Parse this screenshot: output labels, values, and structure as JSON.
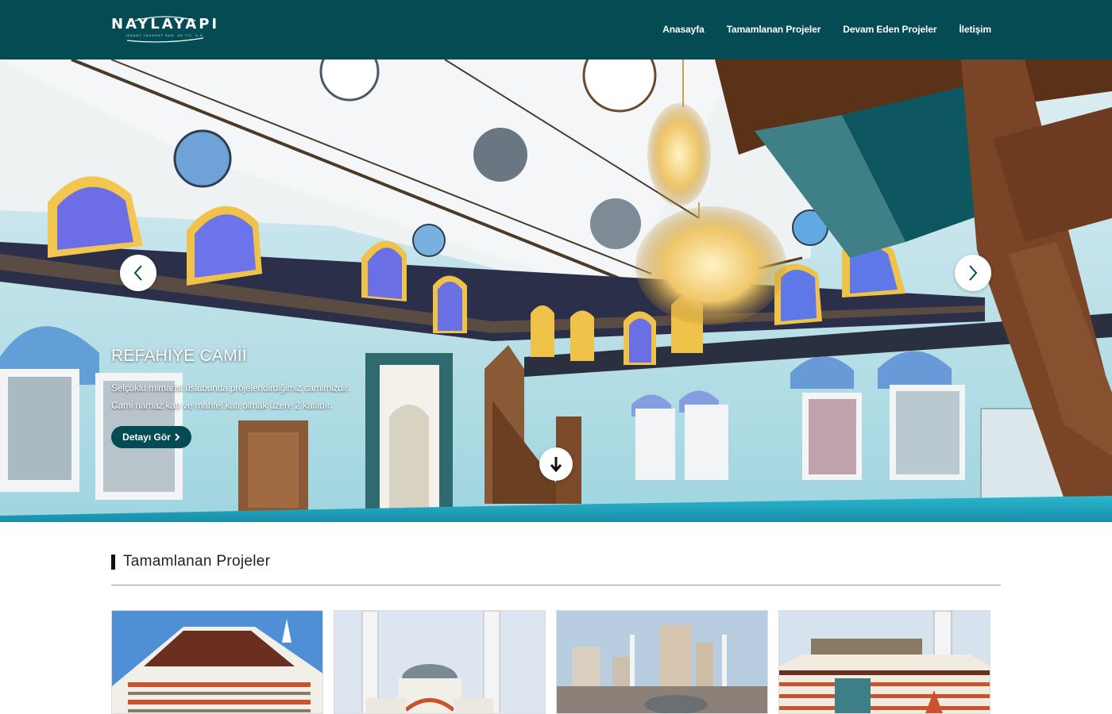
{
  "header": {
    "logo_text": "NAYLAYAPI",
    "logo_subtext": "İNŞAAT TAAHHÜT SAN. VE TİC. A.Ş.",
    "nav": [
      {
        "label": "Anasayfa"
      },
      {
        "label": "Tamamlanan Projeler"
      },
      {
        "label": "Devam Eden Projeler"
      },
      {
        "label": "İletişim"
      }
    ]
  },
  "hero": {
    "title": "REFAHİYE CAMİİ",
    "line1": "Selçuklu mimarisi üslubunda projelendirdiğimiz camimizdir.",
    "line2": "Cami namaz katı ve mahfel katı olmak üzere 2 katlıdır.",
    "button_label": "Detayı Gör",
    "prev_icon": "chevron-left-icon",
    "next_icon": "chevron-right-icon",
    "scroll_icon": "arrow-down-icon"
  },
  "section": {
    "title": "Tamamlanan Projeler"
  },
  "colors": {
    "brand": "#044b53",
    "accent_text": "#ffffff"
  }
}
